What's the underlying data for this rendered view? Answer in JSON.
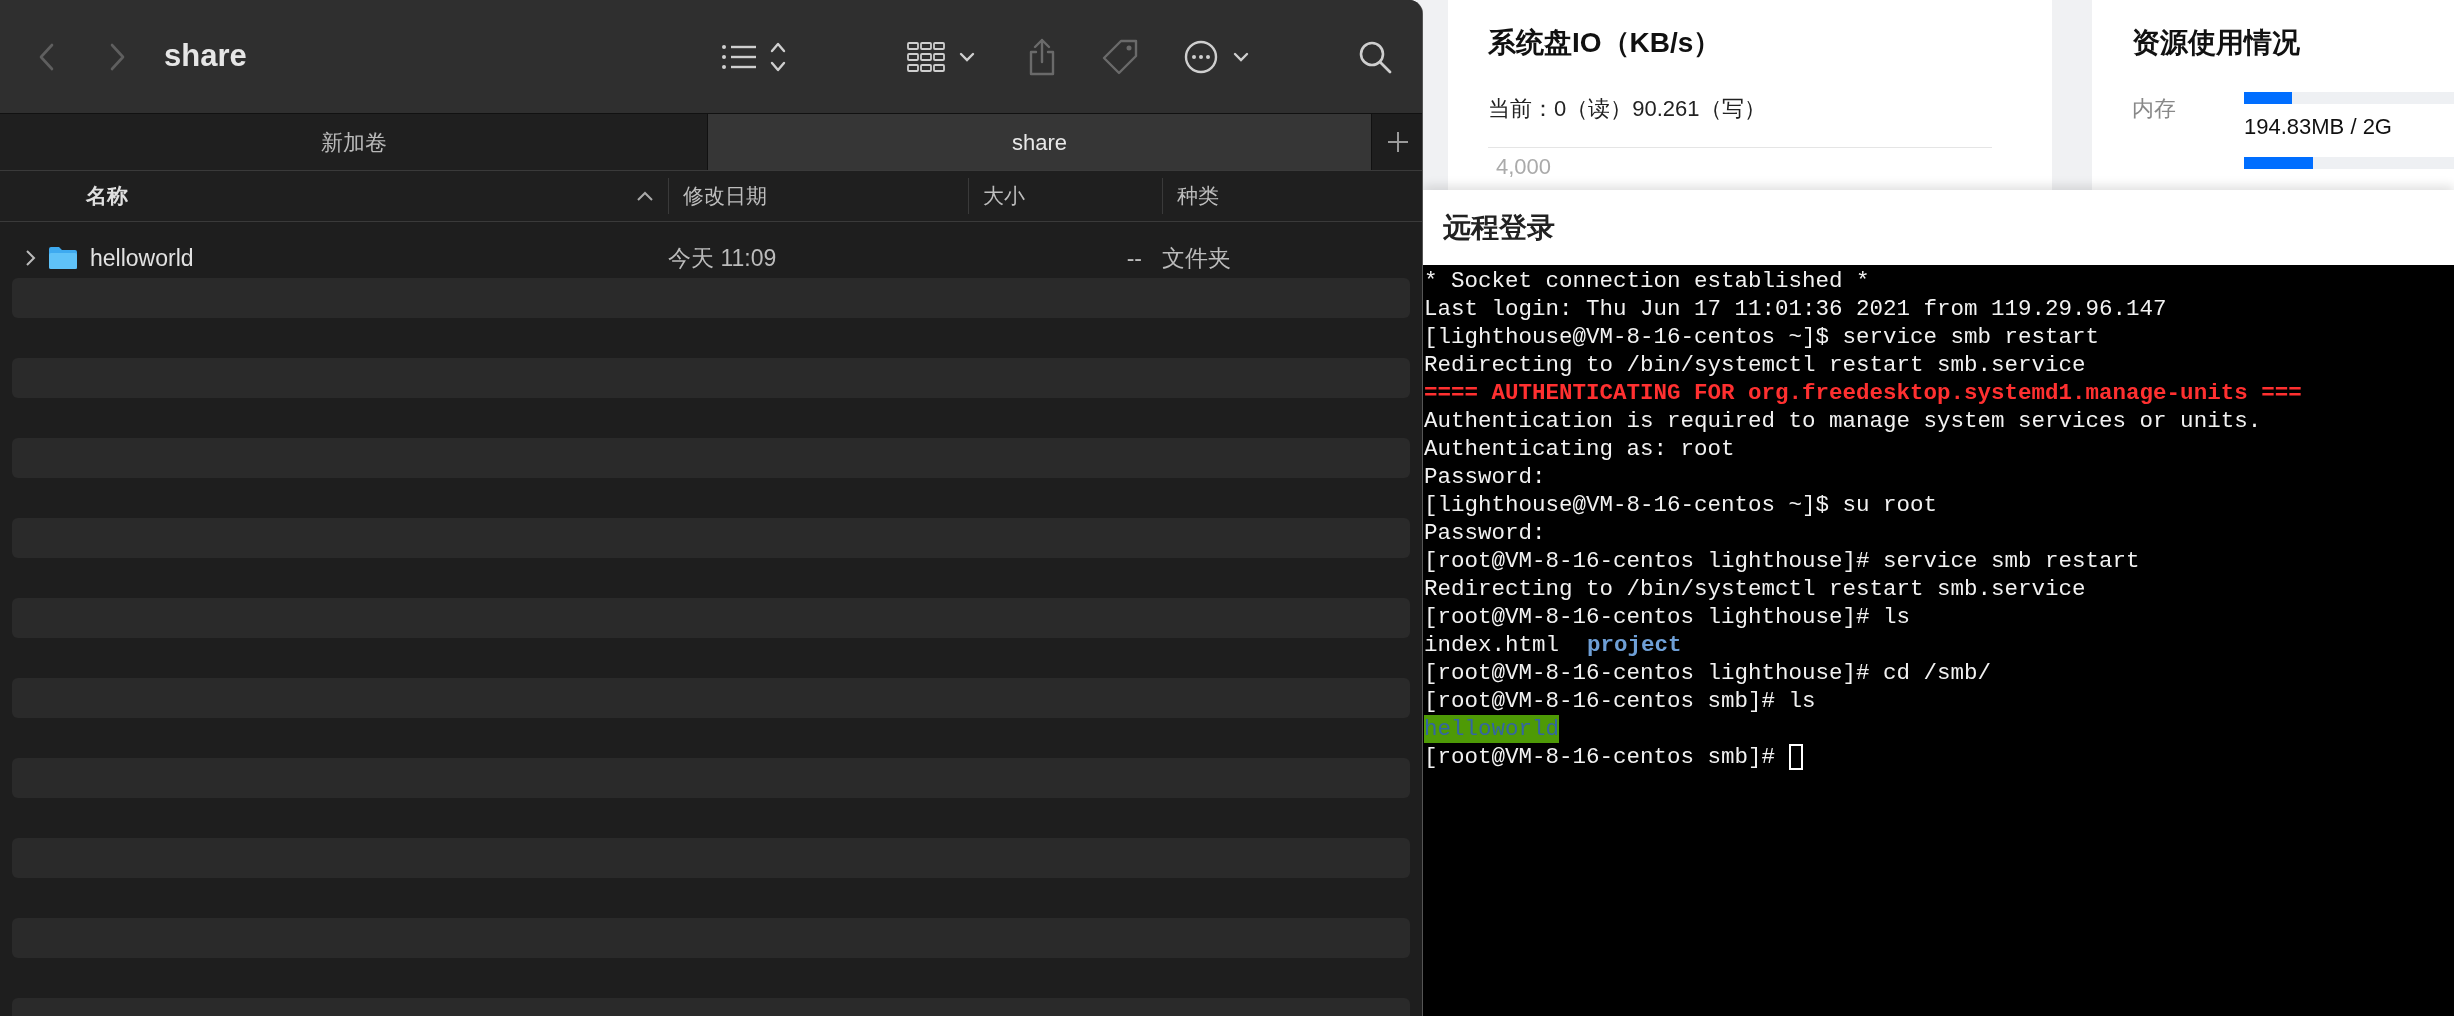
{
  "finder": {
    "nav": [
      {
        "kind": "back",
        "disabled": true
      },
      {
        "kind": "forward",
        "disabled": true
      }
    ],
    "title": "share",
    "tabs": [
      {
        "label": "新加卷",
        "selected": false
      },
      {
        "label": "share",
        "selected": true
      }
    ],
    "columns": [
      {
        "label": "名称",
        "sorted": true
      },
      {
        "label": "修改日期",
        "sorted": false
      },
      {
        "label": "大小",
        "sorted": false
      },
      {
        "label": "种类",
        "sorted": false
      }
    ],
    "rows": [
      {
        "name": "helloworld",
        "date": "今天 11:09",
        "size": "--",
        "kind": "文件夹",
        "expanded": false
      }
    ]
  },
  "console_page": {
    "io_card": {
      "title": "系统盘IO（KB/s）",
      "current": "当前：0（读）90.261（写）",
      "y_tick": "4,000"
    },
    "resource_card": {
      "title": "资源使用情况",
      "items": [
        {
          "label": "内存",
          "level": 0.23,
          "reading": "194.83MB / 2G"
        },
        {
          "level": 0.33
        }
      ]
    },
    "remote_login": {
      "title": "远程登录",
      "terminal_lines": [
        [
          {
            "text": "* Socket connection established *",
            "kind": "plain"
          }
        ],
        [
          {
            "text": "Last login: Thu Jun 17 11:01:36 2021 from 119.29.96.147",
            "kind": "plain"
          }
        ],
        [
          {
            "text": "[lighthouse@VM-8-16-centos ~]$ service smb restart",
            "kind": "plain"
          }
        ],
        [
          {
            "text": "Redirecting to /bin/systemctl restart smb.service",
            "kind": "plain"
          }
        ],
        [
          {
            "text": "==== AUTHENTICATING FOR org.freedesktop.systemd1.manage-units ===",
            "kind": "alert"
          }
        ],
        [
          {
            "text": "Authentication is required to manage system services or units.",
            "kind": "plain"
          }
        ],
        [
          {
            "text": "Authenticating as: root",
            "kind": "plain"
          }
        ],
        [
          {
            "text": "Password:",
            "kind": "plain"
          }
        ],
        [
          {
            "text": "[lighthouse@VM-8-16-centos ~]$ su root",
            "kind": "plain"
          }
        ],
        [
          {
            "text": "Password:",
            "kind": "plain"
          }
        ],
        [
          {
            "text": "[root@VM-8-16-centos lighthouse]# service smb restart",
            "kind": "plain"
          }
        ],
        [
          {
            "text": "Redirecting to /bin/systemctl restart smb.service",
            "kind": "plain"
          }
        ],
        [
          {
            "text": "[root@VM-8-16-centos lighthouse]# ls",
            "kind": "plain"
          }
        ],
        [
          {
            "text": "index.html",
            "kind": "plain"
          },
          {
            "text": "project",
            "kind": "dir"
          }
        ],
        [
          {
            "text": "[root@VM-8-16-centos lighthouse]# cd /smb/",
            "kind": "plain"
          }
        ],
        [
          {
            "text": "[root@VM-8-16-centos smb]# ls",
            "kind": "plain"
          }
        ],
        [
          {
            "text": "helloworld",
            "kind": "shared_dir"
          }
        ],
        [
          {
            "text": "[root@VM-8-16-centos smb]#",
            "kind": "plain"
          }
        ]
      ],
      "cursor": true
    }
  }
}
